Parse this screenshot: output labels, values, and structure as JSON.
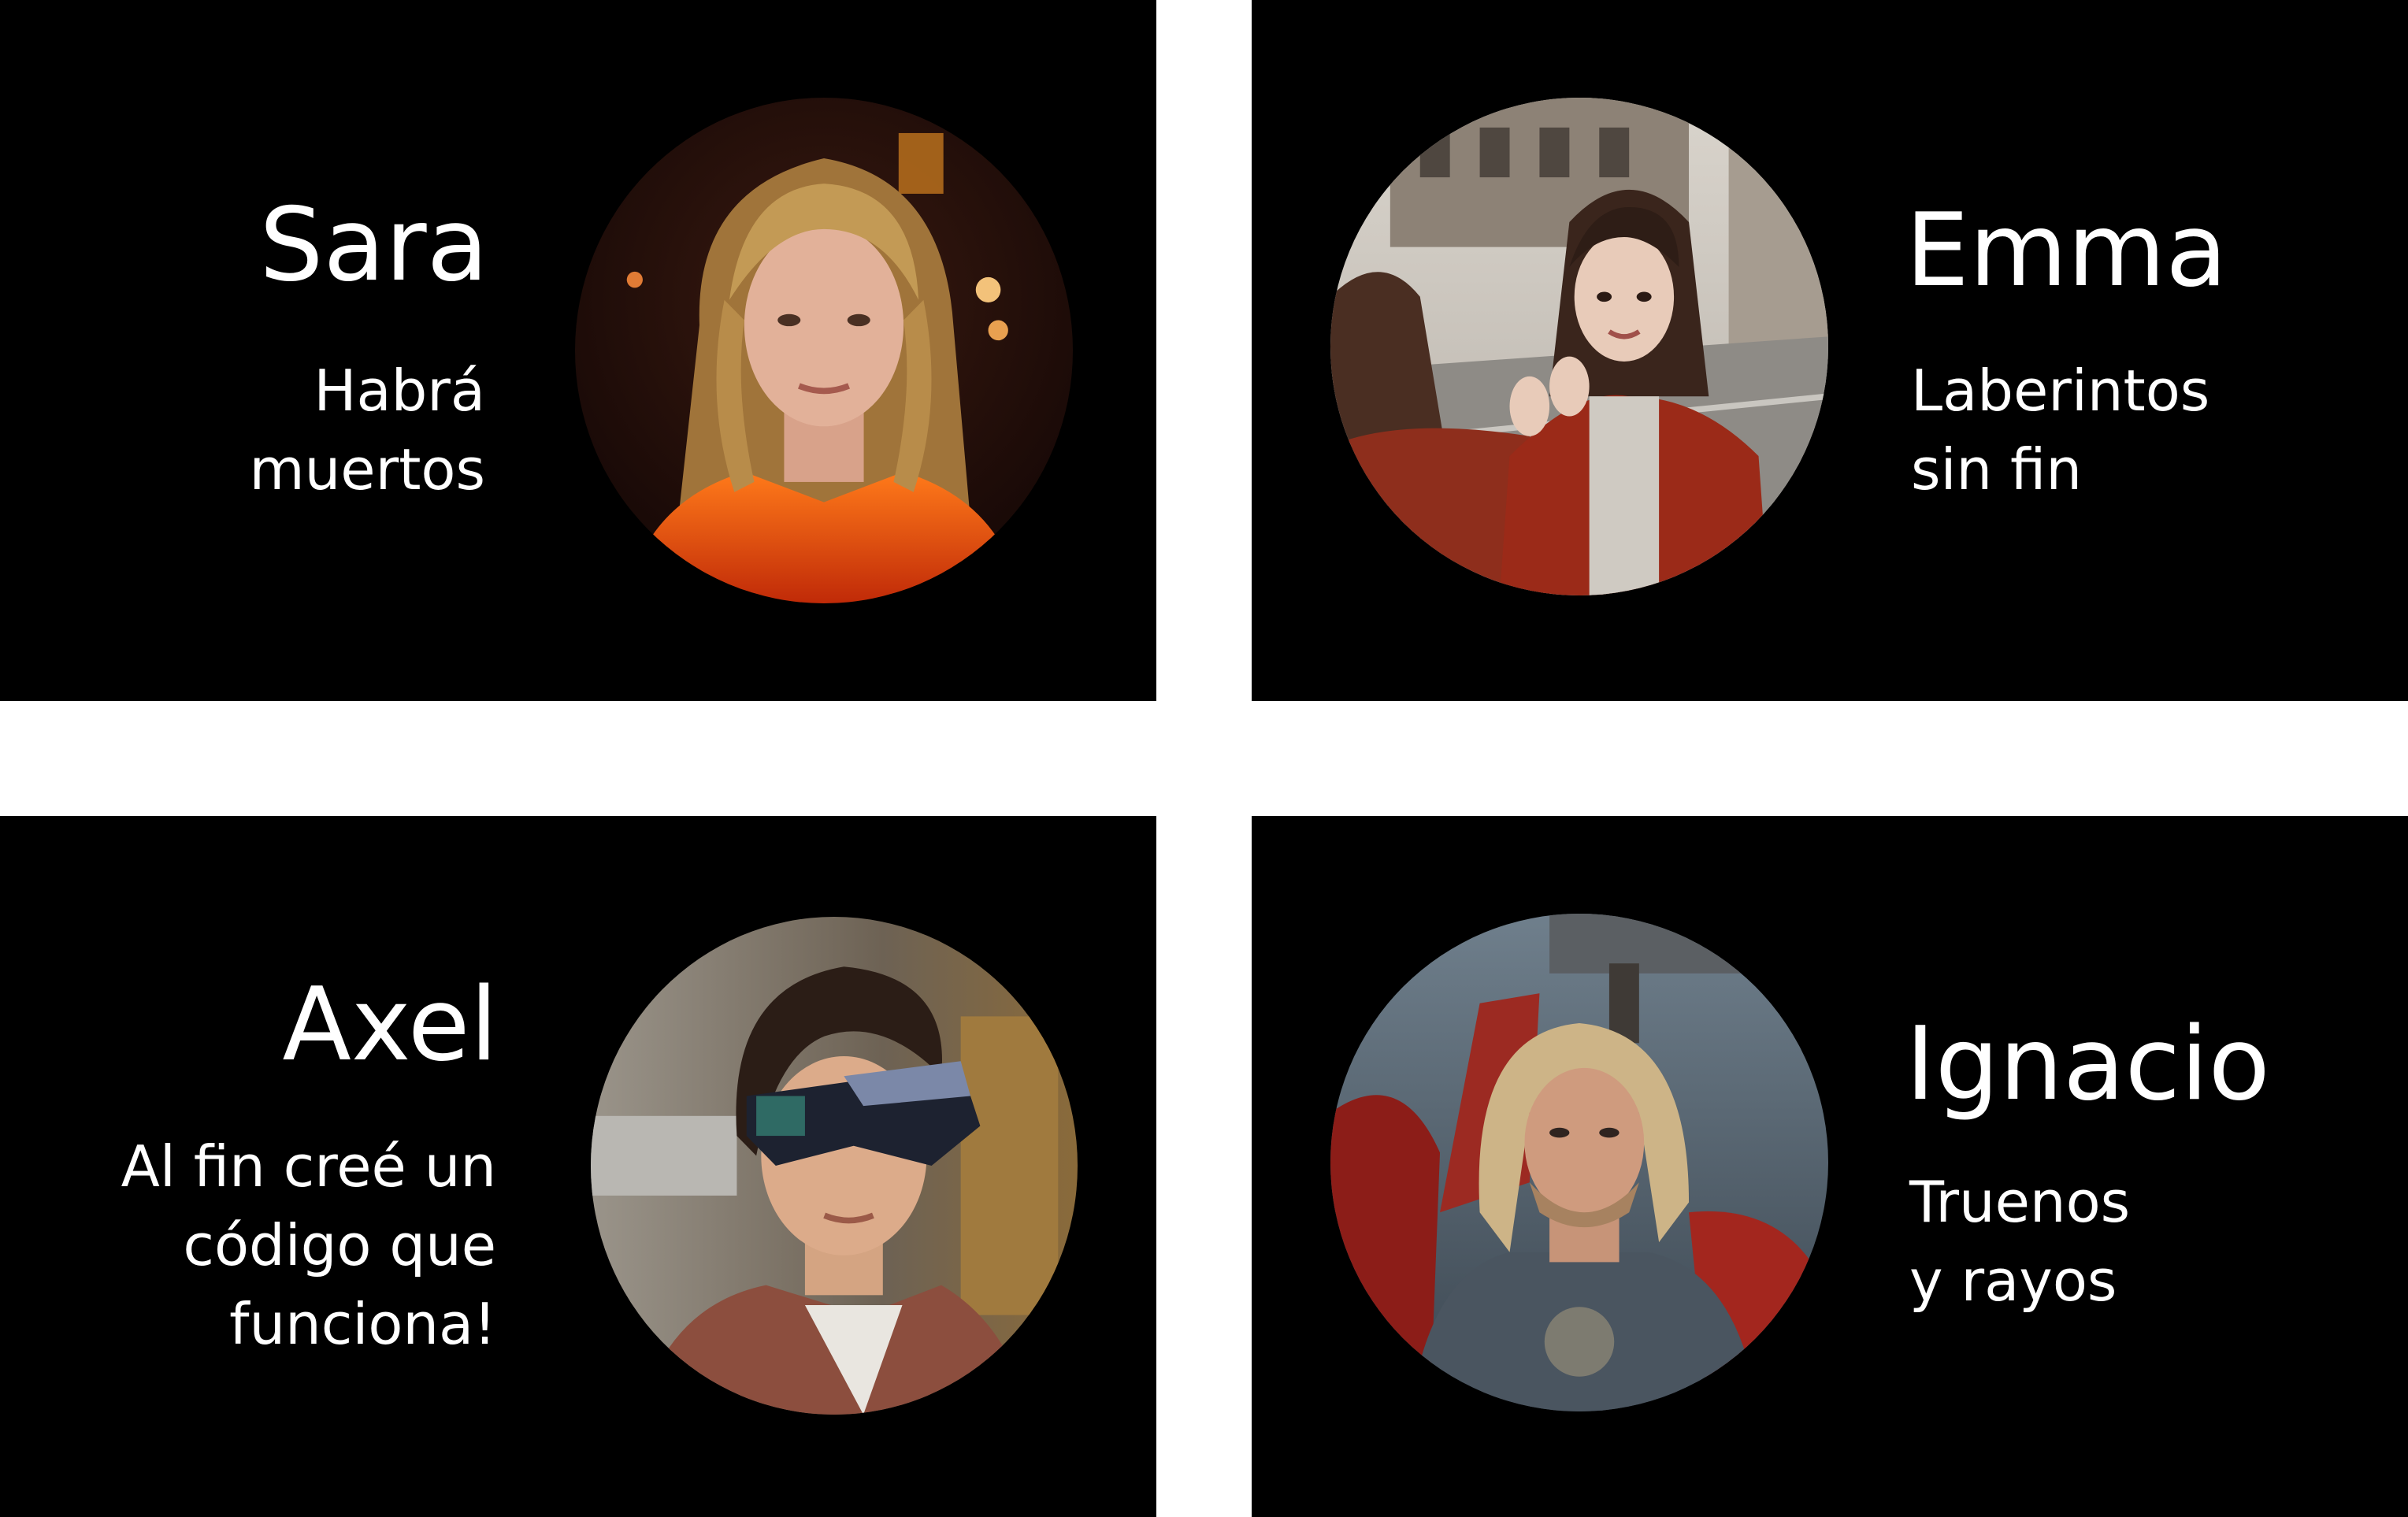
{
  "cards": [
    {
      "name": "Sara",
      "quote_lines": [
        "Habrá",
        "muertos"
      ],
      "avatar_icon": "portrait-woman-blonde-orange-jacket"
    },
    {
      "name": "Emma",
      "quote_lines": [
        "Laberintos",
        "sin fin"
      ],
      "avatar_icon": "portrait-woman-street-red-coat"
    },
    {
      "name": "Axel",
      "quote_lines": [
        "Al fin creé un",
        "código que",
        "funciona!"
      ],
      "avatar_icon": "portrait-man-vr-visor"
    },
    {
      "name": "Ignacio",
      "quote_lines": [
        "Truenos",
        "y rayos"
      ],
      "avatar_icon": "portrait-man-armor-hammer"
    }
  ],
  "colors": {
    "page_background": "#ffffff",
    "card_background": "#000000",
    "text": "#ffffff"
  }
}
